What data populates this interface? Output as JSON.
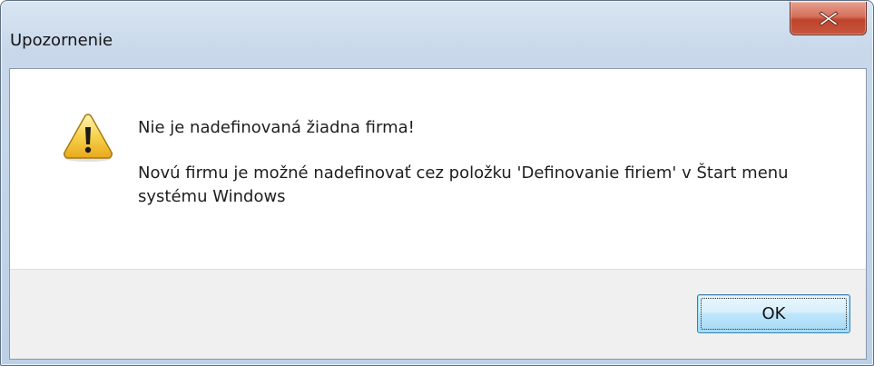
{
  "window": {
    "title": "Upozornenie"
  },
  "titlebar": {
    "close_icon": "close-icon"
  },
  "message": {
    "icon": "warning-icon",
    "line1": "Nie je nadefinovaná žiadna firma!",
    "line2": "Novú firmu je možné nadefinovať cez položku 'Definovanie firiem' v Štart menu systému Windows"
  },
  "buttons": {
    "ok_label": "OK"
  },
  "colors": {
    "close_button": "#c6573d",
    "ok_button_border": "#3c7fb1",
    "warning_fill": "#f3c63d"
  }
}
